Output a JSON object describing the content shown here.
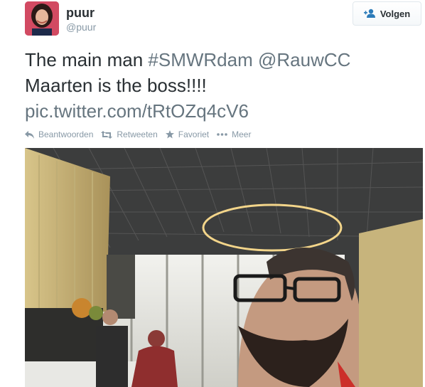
{
  "user": {
    "display_name": "puur",
    "screen_name": "@puur"
  },
  "follow_button": {
    "label": "Volgen",
    "icon": "follow-user-icon"
  },
  "tweet": {
    "text_1": "The main man ",
    "hashtag": "#SMWRdam",
    "text_2": " ",
    "mention": "@RauwCC",
    "line_2": "Maarten is the boss!!!!",
    "link": "pic.twitter.com/tRtOZq4cV6"
  },
  "actions": [
    {
      "label": "Beantwoorden",
      "icon": "reply-icon"
    },
    {
      "label": "Retweeten",
      "icon": "retweet-icon"
    },
    {
      "label": "Favoriet",
      "icon": "star-icon"
    },
    {
      "label": "Meer",
      "icon": "more-dots-icon"
    }
  ],
  "colors": {
    "text": "#292f33",
    "muted": "#8899a6",
    "link": "#66757f"
  }
}
